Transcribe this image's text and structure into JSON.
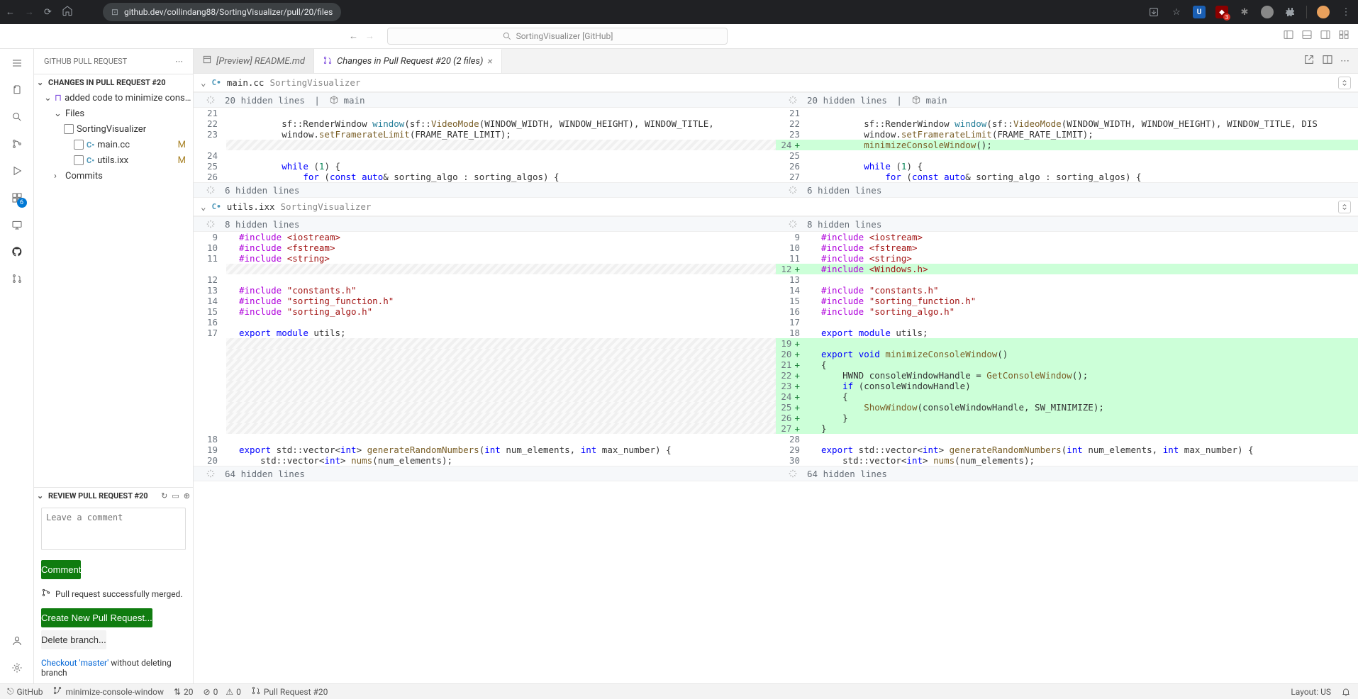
{
  "browser": {
    "url": "github.dev/collindang88/SortingVisualizer/pull/20/files"
  },
  "searchBox": "SortingVisualizer [GitHub]",
  "sidebar": {
    "title": "GITHUB PULL REQUEST",
    "changesHeader": "CHANGES IN PULL REQUEST #20",
    "commitMsg": "added code to minimize console wind...",
    "filesLabel": "Files",
    "folderName": "SortingVisualizer",
    "files": [
      {
        "name": "main.cc",
        "status": "M"
      },
      {
        "name": "utils.ixx",
        "status": "M"
      }
    ],
    "commitsLabel": "Commits",
    "reviewHeader": "REVIEW PULL REQUEST #20",
    "commentPlaceholder": "Leave a comment",
    "commentBtn": "Comment",
    "mergeStatus": "Pull request successfully merged.",
    "createPrBtn": "Create New Pull Request...",
    "deleteBranchBtn": "Delete branch...",
    "checkoutPrefix": "Checkout 'master'",
    "checkoutSuffix": " without deleting branch"
  },
  "tabs": [
    {
      "label": "[Preview] README.md",
      "active": false
    },
    {
      "label": "Changes in Pull Request #20 (2 files)",
      "active": true
    }
  ],
  "diffFiles": [
    {
      "name": "main.cc",
      "path": "SortingVisualizer",
      "topHunk": {
        "text": "20 hidden lines",
        "scope": "main"
      },
      "bottomHunk": "6 hidden lines",
      "leftLines": [
        {
          "n": 21,
          "html": ""
        },
        {
          "n": 22,
          "html": "        sf::RenderWindow <span class='ty'>window</span>(sf::<span class='fn'>VideoMode</span>(WINDOW_WIDTH, WINDOW_HEIGHT), WINDOW_TITLE,"
        },
        {
          "n": 23,
          "html": "        window.<span class='fn'>setFramerateLimit</span>(FRAME_RATE_LIMIT);"
        },
        {
          "n": "",
          "html": "",
          "empty": true
        },
        {
          "n": 24,
          "html": ""
        },
        {
          "n": 25,
          "html": "        <span class='kw'>while</span> (<span class='nm'>1</span>) {"
        },
        {
          "n": 26,
          "html": "            <span class='kw'>for</span> (<span class='kw'>const</span> <span class='kw'>auto</span>& sorting_algo : sorting_algos) {"
        }
      ],
      "rightLines": [
        {
          "n": 21,
          "html": ""
        },
        {
          "n": 22,
          "html": "        sf::RenderWindow <span class='ty'>window</span>(sf::<span class='fn'>VideoMode</span>(WINDOW_WIDTH, WINDOW_HEIGHT), WINDOW_TITLE, DIS"
        },
        {
          "n": 23,
          "html": "        window.<span class='fn'>setFramerateLimit</span>(FRAME_RATE_LIMIT);"
        },
        {
          "n": 24,
          "html": "        <span class='fn'>minimizeConsoleWindow</span>();",
          "added": true
        },
        {
          "n": 25,
          "html": ""
        },
        {
          "n": 26,
          "html": "        <span class='kw'>while</span> (<span class='nm'>1</span>) {"
        },
        {
          "n": 27,
          "html": "            <span class='kw'>for</span> (<span class='kw'>const</span> <span class='kw'>auto</span>& sorting_algo : sorting_algos) {"
        }
      ]
    },
    {
      "name": "utils.ixx",
      "path": "SortingVisualizer",
      "topHunk": {
        "text": "8 hidden lines",
        "scope": null
      },
      "bottomHunk": "64 hidden lines",
      "leftLines": [
        {
          "n": 9,
          "html": "<span class='pp'>#include</span> <span class='st'>&lt;iostream&gt;</span>"
        },
        {
          "n": 10,
          "html": "<span class='pp'>#include</span> <span class='st'>&lt;fstream&gt;</span>"
        },
        {
          "n": 11,
          "html": "<span class='pp'>#include</span> <span class='st'>&lt;string&gt;</span>"
        },
        {
          "n": "",
          "html": "",
          "empty": true
        },
        {
          "n": 12,
          "html": ""
        },
        {
          "n": 13,
          "html": "<span class='pp'>#include</span> <span class='st'>\"constants.h\"</span>"
        },
        {
          "n": 14,
          "html": "<span class='pp'>#include</span> <span class='st'>\"sorting_function.h\"</span>"
        },
        {
          "n": 15,
          "html": "<span class='pp'>#include</span> <span class='st'>\"sorting_algo.h\"</span>"
        },
        {
          "n": 16,
          "html": ""
        },
        {
          "n": 17,
          "html": "<span class='kw'>export</span> <span class='kw'>module</span> utils;"
        },
        {
          "n": "",
          "html": "",
          "empty": true
        },
        {
          "n": "",
          "html": "",
          "empty": true
        },
        {
          "n": "",
          "html": "",
          "empty": true
        },
        {
          "n": "",
          "html": "",
          "empty": true
        },
        {
          "n": "",
          "html": "",
          "empty": true
        },
        {
          "n": "",
          "html": "",
          "empty": true
        },
        {
          "n": "",
          "html": "",
          "empty": true
        },
        {
          "n": "",
          "html": "",
          "empty": true
        },
        {
          "n": "",
          "html": "",
          "empty": true
        },
        {
          "n": 18,
          "html": ""
        },
        {
          "n": 19,
          "html": "<span class='kw'>export</span> std::vector&lt;<span class='kw'>int</span>&gt; <span class='fn'>generateRandomNumbers</span>(<span class='kw'>int</span> num_elements, <span class='kw'>int</span> max_number) {"
        },
        {
          "n": 20,
          "html": "    std::vector&lt;<span class='kw'>int</span>&gt; <span class='fn'>nums</span>(num_elements);"
        }
      ],
      "rightLines": [
        {
          "n": 9,
          "html": "<span class='pp'>#include</span> <span class='st'>&lt;iostream&gt;</span>"
        },
        {
          "n": 10,
          "html": "<span class='pp'>#include</span> <span class='st'>&lt;fstream&gt;</span>"
        },
        {
          "n": 11,
          "html": "<span class='pp'>#include</span> <span class='st'>&lt;string&gt;</span>"
        },
        {
          "n": 12,
          "html": "<span class='pp'>#include</span> <span class='st'>&lt;Windows.h&gt;</span>",
          "added": true
        },
        {
          "n": 13,
          "html": ""
        },
        {
          "n": 14,
          "html": "<span class='pp'>#include</span> <span class='st'>\"constants.h\"</span>"
        },
        {
          "n": 15,
          "html": "<span class='pp'>#include</span> <span class='st'>\"sorting_function.h\"</span>"
        },
        {
          "n": 16,
          "html": "<span class='pp'>#include</span> <span class='st'>\"sorting_algo.h\"</span>"
        },
        {
          "n": 17,
          "html": ""
        },
        {
          "n": 18,
          "html": "<span class='kw'>export</span> <span class='kw'>module</span> utils;"
        },
        {
          "n": 19,
          "html": "",
          "added": true
        },
        {
          "n": 20,
          "html": "<span class='kw'>export</span> <span class='kw'>void</span> <span class='fn'>minimizeConsoleWindow</span>()",
          "added": true
        },
        {
          "n": 21,
          "html": "{",
          "added": true
        },
        {
          "n": 22,
          "html": "    HWND consoleWindowHandle = <span class='fn'>GetConsoleWindow</span>();",
          "added": true
        },
        {
          "n": 23,
          "html": "    <span class='kw'>if</span> (consoleWindowHandle)",
          "added": true
        },
        {
          "n": 24,
          "html": "    {",
          "added": true
        },
        {
          "n": 25,
          "html": "        <span class='fn'>ShowWindow</span>(consoleWindowHandle, SW_MINIMIZE);",
          "added": true
        },
        {
          "n": 26,
          "html": "    }",
          "added": true
        },
        {
          "n": 27,
          "html": "}",
          "added": true
        },
        {
          "n": 28,
          "html": ""
        },
        {
          "n": 29,
          "html": "<span class='kw'>export</span> std::vector&lt;<span class='kw'>int</span>&gt; <span class='fn'>generateRandomNumbers</span>(<span class='kw'>int</span> num_elements, <span class='kw'>int</span> max_number) {"
        },
        {
          "n": 30,
          "html": "    std::vector&lt;<span class='kw'>int</span>&gt; <span class='fn'>nums</span>(num_elements);"
        }
      ]
    }
  ],
  "statusBar": {
    "remote": "GitHub",
    "branch": "minimize-console-window",
    "sync": "20",
    "errors": "0",
    "warnings": "0",
    "pr": "Pull Request #20",
    "layout": "Layout: US"
  }
}
